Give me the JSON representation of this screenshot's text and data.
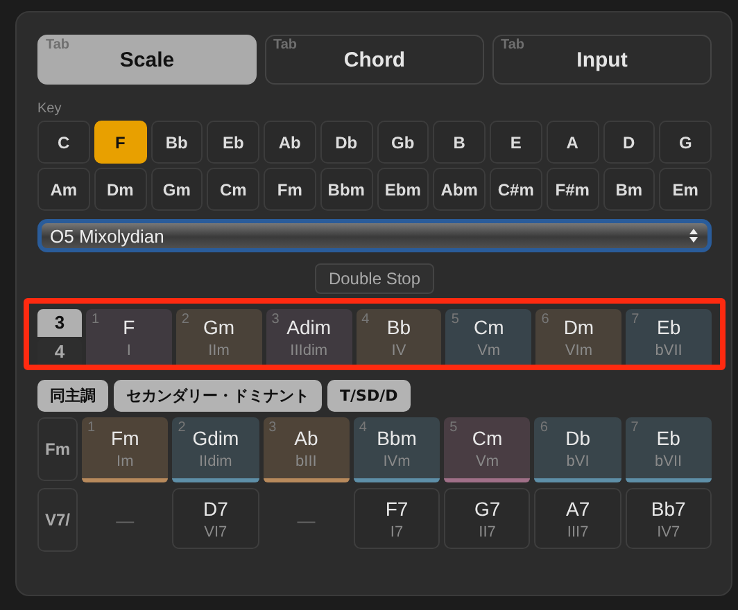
{
  "tabs": [
    {
      "hint": "Tab",
      "label": "Scale",
      "selected": true
    },
    {
      "hint": "Tab",
      "label": "Chord",
      "selected": false
    },
    {
      "hint": "Tab",
      "label": "Input",
      "selected": false
    }
  ],
  "key": {
    "label": "Key",
    "rows": [
      [
        {
          "label": "C",
          "selected": false
        },
        {
          "label": "F",
          "selected": true
        },
        {
          "label": "Bb",
          "selected": false
        },
        {
          "label": "Eb",
          "selected": false
        },
        {
          "label": "Ab",
          "selected": false
        },
        {
          "label": "Db",
          "selected": false
        },
        {
          "label": "Gb",
          "selected": false
        },
        {
          "label": "B",
          "selected": false
        },
        {
          "label": "E",
          "selected": false
        },
        {
          "label": "A",
          "selected": false
        },
        {
          "label": "D",
          "selected": false
        },
        {
          "label": "G",
          "selected": false
        }
      ],
      [
        {
          "label": "Am",
          "selected": false
        },
        {
          "label": "Dm",
          "selected": false
        },
        {
          "label": "Gm",
          "selected": false
        },
        {
          "label": "Cm",
          "selected": false
        },
        {
          "label": "Fm",
          "selected": false
        },
        {
          "label": "Bbm",
          "selected": false
        },
        {
          "label": "Ebm",
          "selected": false
        },
        {
          "label": "Abm",
          "selected": false
        },
        {
          "label": "C#m",
          "selected": false
        },
        {
          "label": "F#m",
          "selected": false
        },
        {
          "label": "Bm",
          "selected": false
        },
        {
          "label": "Em",
          "selected": false
        }
      ]
    ]
  },
  "scale_select": {
    "value": "O5 Mixolydian"
  },
  "double_stop_button": "Double Stop",
  "diatonic": {
    "voicing": [
      {
        "label": "3",
        "selected": true
      },
      {
        "label": "4",
        "selected": false
      }
    ],
    "chords": [
      {
        "degree": "1",
        "name": "F",
        "numeral": "I",
        "color": "#403a40"
      },
      {
        "degree": "2",
        "name": "Gm",
        "numeral": "IIm",
        "color": "#4a4239"
      },
      {
        "degree": "3",
        "name": "Adim",
        "numeral": "IIIdim",
        "color": "#403a40"
      },
      {
        "degree": "4",
        "name": "Bb",
        "numeral": "IV",
        "color": "#4a4239"
      },
      {
        "degree": "5",
        "name": "Cm",
        "numeral": "Vm",
        "color": "#38444b"
      },
      {
        "degree": "6",
        "name": "Dm",
        "numeral": "VIm",
        "color": "#4a4239"
      },
      {
        "degree": "7",
        "name": "Eb",
        "numeral": "bVII",
        "color": "#38444b"
      }
    ]
  },
  "mode_buttons": [
    "同主調",
    "セカンダリー・ドミナント",
    "T/SD/D"
  ],
  "parallel": {
    "label": "Fm",
    "chords": [
      {
        "degree": "1",
        "name": "Fm",
        "numeral": "Im",
        "color": "#b88a5c"
      },
      {
        "degree": "2",
        "name": "Gdim",
        "numeral": "IIdim",
        "color": "#5e8fa8"
      },
      {
        "degree": "3",
        "name": "Ab",
        "numeral": "bIII",
        "color": "#b88a5c"
      },
      {
        "degree": "4",
        "name": "Bbm",
        "numeral": "IVm",
        "color": "#5e8fa8"
      },
      {
        "degree": "5",
        "name": "Cm",
        "numeral": "Vm",
        "color": "#a07088"
      },
      {
        "degree": "6",
        "name": "Db",
        "numeral": "bVI",
        "color": "#5e8fa8"
      },
      {
        "degree": "7",
        "name": "Eb",
        "numeral": "bVII",
        "color": "#5e8fa8"
      }
    ]
  },
  "secondary": {
    "label": "V7/",
    "chords": [
      {
        "kind": "empty",
        "name": "—"
      },
      {
        "kind": "chord",
        "name": "D7",
        "numeral": "VI7"
      },
      {
        "kind": "empty",
        "name": "—"
      },
      {
        "kind": "chord",
        "name": "F7",
        "numeral": "I7"
      },
      {
        "kind": "chord",
        "name": "G7",
        "numeral": "II7"
      },
      {
        "kind": "chord",
        "name": "A7",
        "numeral": "III7"
      },
      {
        "kind": "chord",
        "name": "Bb7",
        "numeral": "IV7"
      }
    ]
  }
}
